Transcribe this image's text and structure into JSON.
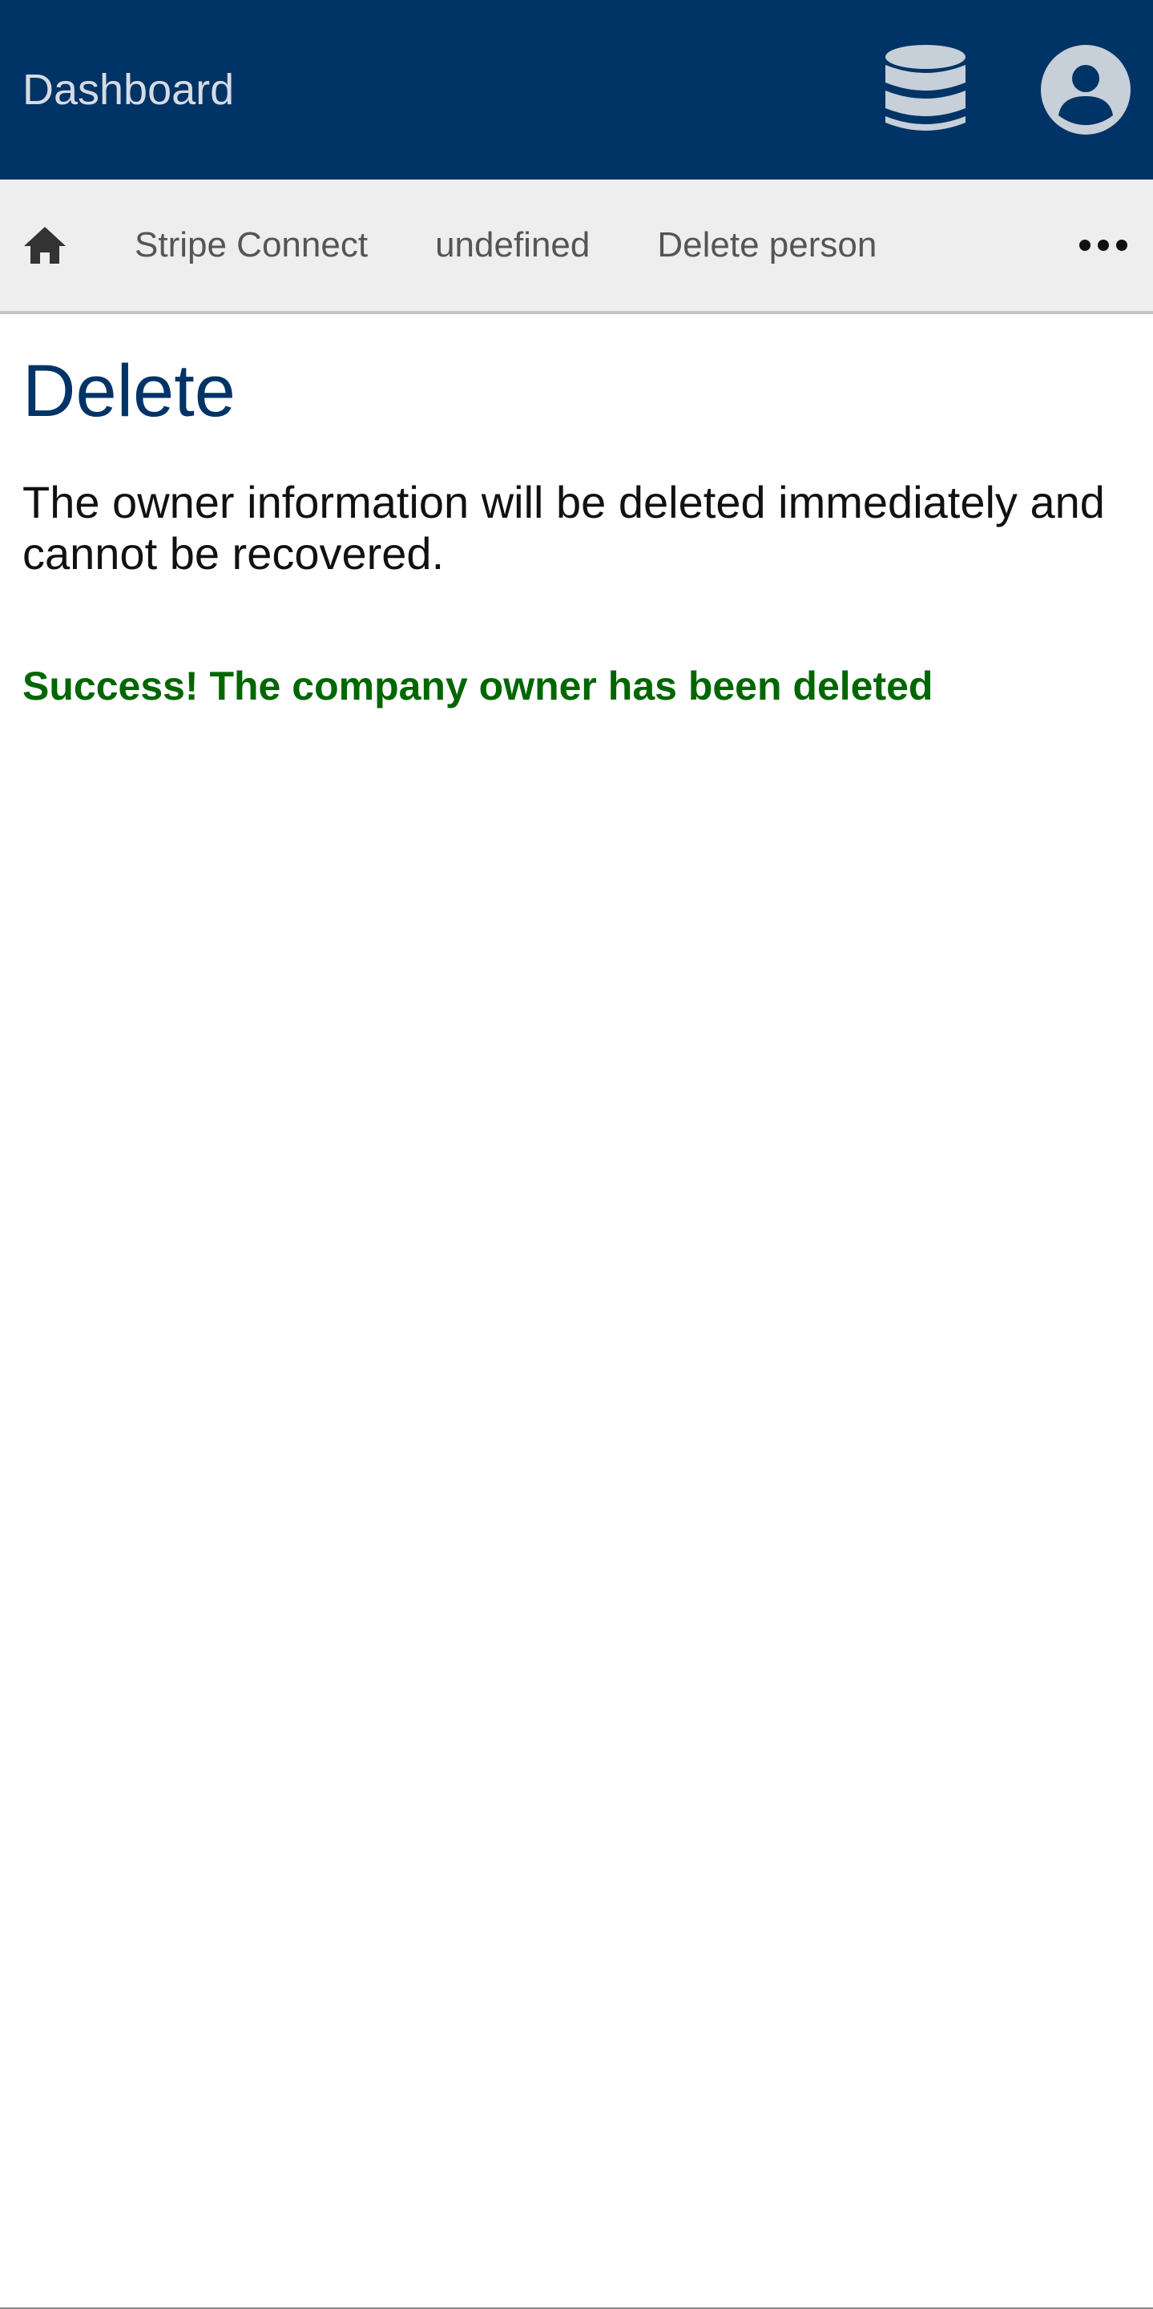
{
  "header": {
    "title": "Dashboard",
    "database_icon": "database-icon",
    "account_icon": "user-circle-icon"
  },
  "nav": {
    "home_icon": "home-icon",
    "items": [
      {
        "label": "Stripe Connect"
      },
      {
        "label": "undefined"
      },
      {
        "label": "Delete person"
      }
    ],
    "more_icon": "more-horizontal-icon"
  },
  "main": {
    "title": "Delete",
    "description": "The owner information will be deleted immediately and cannot be recovered.",
    "success_message": "Success! The company owner has been deleted"
  },
  "colors": {
    "header_bg": "#003366",
    "nav_bg": "#eeeeee",
    "title": "#003366",
    "success": "#006600",
    "icon": "#c7cfd9"
  }
}
